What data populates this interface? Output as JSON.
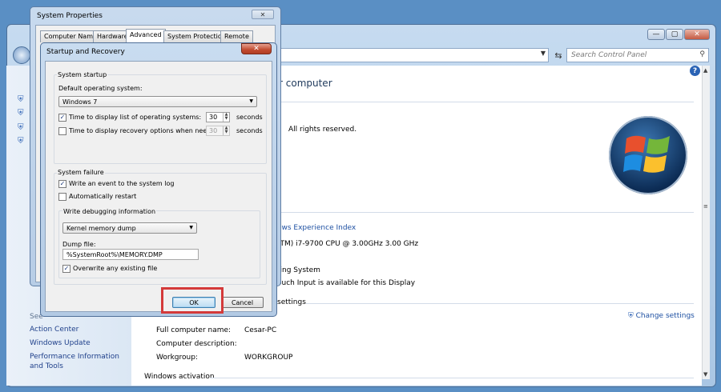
{
  "control_panel": {
    "search_placeholder": "Search Control Panel",
    "heading": "r computer",
    "copyright": "All rights reserved.",
    "experience_index": "ows Experience Index",
    "processor": "(TM) i7-9700 CPU @ 3.00GHz   3.00 GHz",
    "system_type": "ting System",
    "pen_touch": "ouch Input is available for this Display",
    "settings_section": "settings",
    "change_settings": "Change settings",
    "full_computer_name_label": "Full computer name:",
    "full_computer_name": "Cesar-PC",
    "computer_description_label": "Computer description:",
    "workgroup_label": "Workgroup:",
    "workgroup": "WORKGROUP",
    "windows_activation": "Windows activation",
    "see_also": "See",
    "left_links": [
      "Action Center",
      "Windows Update",
      "Performance Information and Tools"
    ]
  },
  "system_properties": {
    "title": "System Properties",
    "tabs": [
      "Computer Name",
      "Hardware",
      "Advanced",
      "System Protection",
      "Remote"
    ],
    "active_tab": "Advanced"
  },
  "startup_recovery": {
    "title": "Startup and Recovery",
    "system_startup": {
      "group_label": "System startup",
      "default_os_label": "Default operating system:",
      "default_os": "Windows 7",
      "display_list_label": "Time to display list of operating systems:",
      "display_list_checked": true,
      "display_list_value": "30",
      "display_recovery_label": "Time to display recovery options when needed:",
      "display_recovery_checked": false,
      "display_recovery_value": "30",
      "seconds": "seconds"
    },
    "system_failure": {
      "group_label": "System failure",
      "write_event_label": "Write an event to the system log",
      "write_event_checked": true,
      "auto_restart_label": "Automatically restart",
      "auto_restart_checked": false,
      "debug_group_label": "Write debugging information",
      "debug_type": "Kernel memory dump",
      "dump_file_label": "Dump file:",
      "dump_file": "%SystemRoot%\\MEMORY.DMP",
      "overwrite_label": "Overwrite any existing file",
      "overwrite_checked": true
    },
    "ok_label": "OK",
    "cancel_label": "Cancel"
  },
  "colors": {
    "highlight_box": "#d43a3a",
    "link": "#1e50a2",
    "window_frame": "#b3cae4"
  }
}
